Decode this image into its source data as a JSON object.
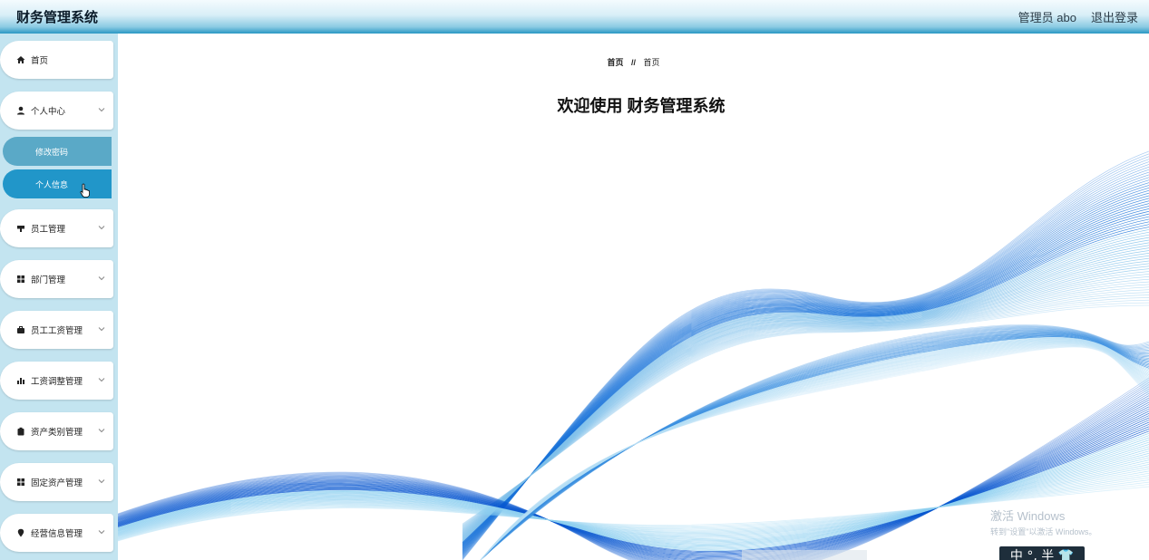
{
  "header": {
    "title": "财务管理系统",
    "user_label": "管理员 abo",
    "logout_label": "退出登录"
  },
  "sidebar": {
    "items": [
      {
        "label": "首页",
        "icon": "home-icon"
      },
      {
        "label": "个人中心",
        "icon": "user-icon",
        "expanded": true
      },
      {
        "label": "员工管理",
        "icon": "badge-icon"
      },
      {
        "label": "部门管理",
        "icon": "grid-icon"
      },
      {
        "label": "员工工资管理",
        "icon": "briefcase-icon"
      },
      {
        "label": "工资调整管理",
        "icon": "bar-chart-icon"
      },
      {
        "label": "资产类别管理",
        "icon": "clipboard-icon"
      },
      {
        "label": "固定资产管理",
        "icon": "grid-icon"
      },
      {
        "label": "经营信息管理",
        "icon": "location-pin-icon"
      }
    ],
    "submenu": [
      {
        "label": "修改密码"
      },
      {
        "label": "个人信息",
        "active": true
      }
    ]
  },
  "main": {
    "breadcrumb": {
      "home": "首页",
      "separator": "//",
      "current": "首页"
    },
    "welcome": "欢迎使用 财务管理系统"
  },
  "overlay": {
    "activate_title": "激活 Windows",
    "activate_hint": "转到\"设置\"以激活 Windows。",
    "ime_text": "中 °, 半 👕"
  },
  "colors": {
    "accent": "#2196c9",
    "sidebar_bg": "#c3e4f0",
    "header_gradient_end": "#2a98c4"
  }
}
